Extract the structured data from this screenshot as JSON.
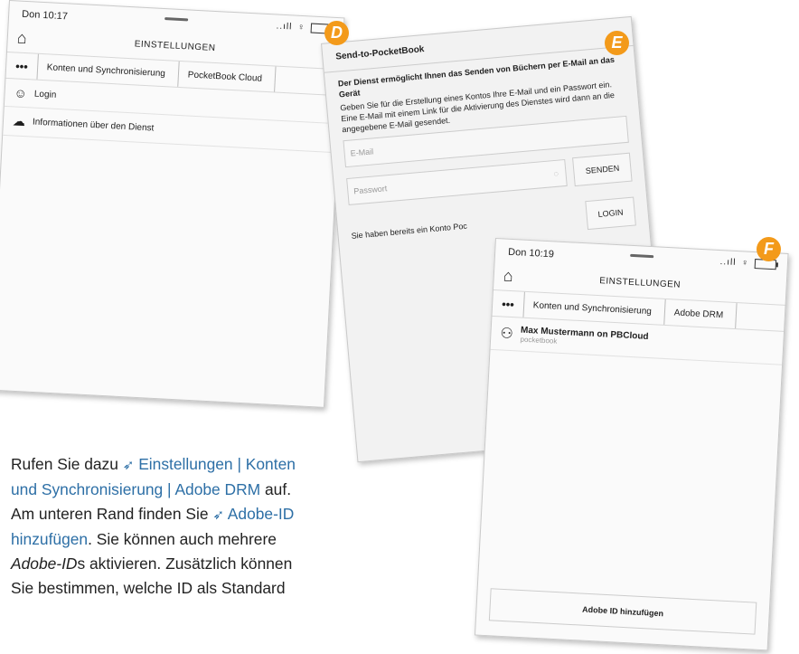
{
  "device_d": {
    "time": "Don 10:17",
    "signal": "..ıll",
    "title": "EINSTELLUNGEN",
    "breadcrumb": [
      "•••",
      "Konten und Synchronisierung",
      "PocketBook Cloud"
    ],
    "items": [
      {
        "icon": "user-icon",
        "label": "Login"
      },
      {
        "icon": "cloud-info-icon",
        "label": "Informationen über den Dienst"
      }
    ]
  },
  "device_e": {
    "title": "Send-to-PocketBook",
    "heading": "Der Dienst ermöglicht Ihnen das Senden von Büchern per E-Mail an das Gerät",
    "body": "Geben Sie für die Erstellung eines Kontos Ihre E-Mail und ein Passwort ein. Eine E-Mail mit einem Link für die Aktivierung des Dienstes wird dann an die angegebene E-Mail gesendet.",
    "email_placeholder": "E-Mail",
    "password_placeholder": "Passwort",
    "send_label": "SENDEN",
    "account_text": "Sie haben bereits ein Konto Poc",
    "login_label": "LOGIN"
  },
  "device_f": {
    "time": "Don 10:19",
    "signal": "..ıll",
    "title": "EINSTELLUNGEN",
    "breadcrumb": [
      "•••",
      "Konten und Synchronisierung",
      "Adobe DRM"
    ],
    "account_name": "Max Mustermann on PBCloud",
    "account_sub": "pocketbook",
    "add_label": "Adobe ID hinzufügen"
  },
  "badges": {
    "d": "D",
    "e": "E",
    "f": "F",
    "color": "#f39a1a"
  },
  "text": {
    "p1": "Rufen Sie dazu",
    "link1": "Einstellungen | Konten und Synchronisierung | Adobe DRM",
    "p2": "auf. Am unteren Rand finden Sie",
    "link2": "Adobe-ID hinzufügen",
    "p3": ". Sie können auch mehrere",
    "em1": "Adobe-ID",
    "p4": "s aktivieren. Zusätzlich können Sie bestimmen, welche ID als Standard",
    "link_color": "#2d6fa6"
  }
}
